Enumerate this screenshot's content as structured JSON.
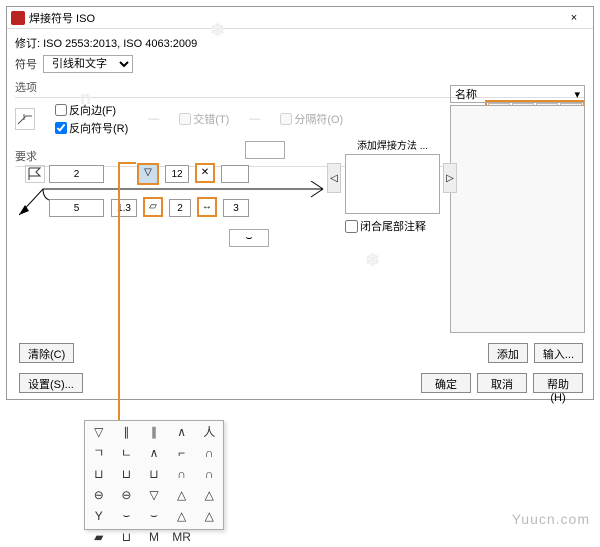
{
  "titlebar": {
    "title": "焊接符号 ISO",
    "close": "×"
  },
  "revision": "修订: ISO 2553:2013, ISO 4063:2009",
  "symbol": {
    "label": "符号",
    "value": "引线和文字"
  },
  "options": {
    "title": "选项",
    "flip_edge": {
      "label": "反向边(F)",
      "checked": false
    },
    "flip_symbol": {
      "label": "反向符号(R)",
      "checked": true
    },
    "stagger": {
      "label": "交错(T)",
      "checked": false
    },
    "spacer": {
      "label": "分隔符(O)",
      "checked": false
    }
  },
  "requirements": {
    "title": "要求"
  },
  "fields": {
    "top_left": "2",
    "top_mid": "12",
    "bot_left": "5",
    "bot_mid1": "1.3",
    "bot_mid2": "2",
    "bot_mid3": "3"
  },
  "method": {
    "title": "添加焊接方法 ...",
    "closed_tail": "闭合尾部注释"
  },
  "rightpanel": {
    "name_label": "名称"
  },
  "buttons": {
    "clear": "清除(C)",
    "settings": "设置(S)...",
    "add": "添加",
    "import": "输入...",
    "ok": "确定",
    "cancel": "取消",
    "help": "帮助(H)"
  },
  "palette": {
    "cells": [
      "▽",
      "∥",
      "∥",
      "∧",
      "人",
      "ㄱ",
      "ㄴ",
      "∧",
      "⌐",
      "∩",
      "⊔",
      "⊔",
      "⊔",
      "∩",
      "∩",
      "⊖",
      "⊖",
      "▽",
      "△",
      "△",
      "Y",
      "⌣",
      "⌣",
      "△",
      "△",
      "▰",
      "⊔",
      "M",
      "MR",
      ""
    ]
  },
  "watermark": "Yuucn.com"
}
